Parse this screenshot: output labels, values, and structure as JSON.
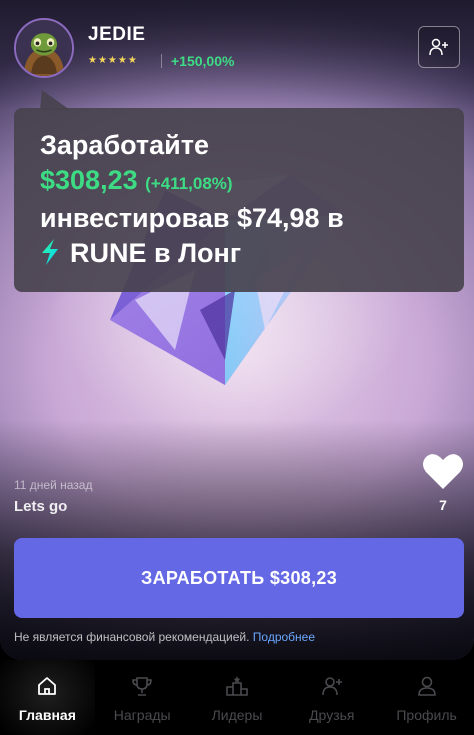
{
  "profile": {
    "username": "JEDIE",
    "stars": "★★★★★",
    "gain": "+150,00%",
    "avatar_icon": "alien-avatar",
    "add_friend_icon": "add-user-icon"
  },
  "promo": {
    "line1": "Заработайте",
    "amount": "$308,23",
    "amount_pct": "(+411,08%)",
    "line3": "инвестировав $74,98 в",
    "asset_line": "RUNE в Лонг",
    "asset_icon": "thorchain-bolt-icon",
    "accent_color": "#3ddc84"
  },
  "post": {
    "time": "11 дней назад",
    "text": "Lets go"
  },
  "likes": {
    "count": "7",
    "icon": "heart-icon"
  },
  "cta": {
    "label": "ЗАРАБОТАТЬ $308,23",
    "color": "#6468e4"
  },
  "disclaimer": {
    "text": "Не является финансовой рекомендацией.",
    "link": "Подробнее"
  },
  "nav": {
    "items": [
      {
        "label": "Главная",
        "icon": "home-icon",
        "active": true
      },
      {
        "label": "Награды",
        "icon": "trophy-icon",
        "active": false
      },
      {
        "label": "Лидеры",
        "icon": "podium-icon",
        "active": false
      },
      {
        "label": "Друзья",
        "icon": "add-user-icon",
        "active": false
      },
      {
        "label": "Профиль",
        "icon": "user-icon",
        "active": false
      }
    ]
  }
}
